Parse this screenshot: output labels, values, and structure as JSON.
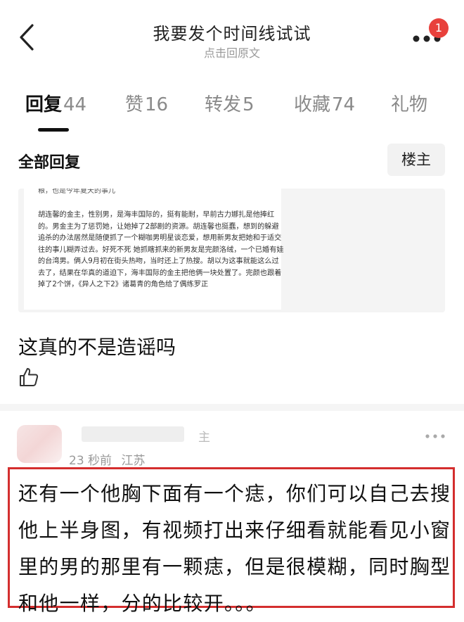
{
  "header": {
    "title": "我要发个时间线试试",
    "subtitle": "点击回原文",
    "notification_count": "1"
  },
  "tabs": [
    {
      "label": "回复",
      "count": "44",
      "active": true
    },
    {
      "label": "赞",
      "count": "16"
    },
    {
      "label": "转发",
      "count": "5"
    },
    {
      "label": "收藏",
      "count": "74"
    },
    {
      "label": "礼物",
      "count": ""
    }
  ],
  "section": {
    "title": "全部回复",
    "filter_label": "楼主"
  },
  "comment1": {
    "embedded_cut_line": "粮，也是今年夏天的事儿",
    "embedded_text": "胡连馨的金主，性别男，是海丰国际的，挺有能耐，早前古力娜扎是他捧红的。男金主为了惩罚她，让她掉了2部剧的资源。胡连馨也挺蠢，想到的躲避追杀的办法居然是随便抓了一个糊咖男明星谈恋爱，想用新男友把她和于适交往的事儿糊弄过去。好死不死 她抓瞎抓来的新男友是完颜洛绒，一个已婚有娃的台湾男。俩人9月初在街头热吻，当时还上了热搜。胡以为这事就能这么过去了，结果在华真的道迫下，海丰国际的金主把他俩一块处置了。完颜也跟着掉了2个饼，《异人之下2》诸葛青的角色给了偶练罗正",
    "text": "这真的不是造谣吗"
  },
  "comment2": {
    "name_tail": "主",
    "time": "23 秒前",
    "location": "江苏",
    "text": "还有一个他胸下面有一个痣，你们可以自己去搜他上半身图，有视频打出来仔细看就能看见小窗里的男的那里有一颗痣，但是很模糊，同时胸型和他一样，分的比较开。。。"
  },
  "colors": {
    "badge": "#e8413c",
    "highlight_border": "#d42e2e",
    "muted_text": "#999999"
  }
}
